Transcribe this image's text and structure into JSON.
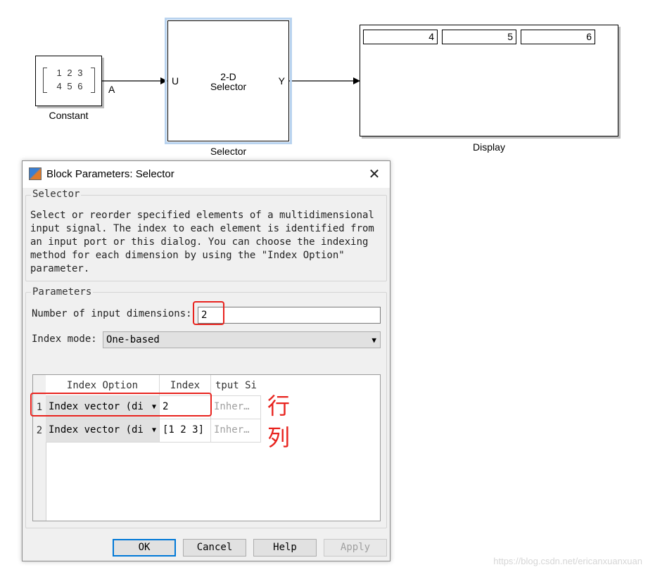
{
  "diagram": {
    "constant": {
      "matrix_rows": [
        "1  2  3",
        "4  5  6"
      ],
      "port_out": "A",
      "label": "Constant"
    },
    "selector": {
      "title_line1": "2-D",
      "title_line2": "Selector",
      "port_in": "U",
      "port_out": "Y",
      "label": "Selector"
    },
    "display": {
      "values": [
        "4",
        "5",
        "6"
      ],
      "label": "Display"
    }
  },
  "dialog": {
    "title": "Block Parameters: Selector",
    "selector_group_title": "Selector",
    "description": "Select or reorder specified elements of a multidimensional\ninput signal. The index to each element is identified from\nan input port or this dialog. You can choose the indexing\nmethod for each dimension by using the \"Index Option\"\nparameter.",
    "parameters_group_title": "Parameters",
    "num_dims_label": "Number of input dimensions:",
    "num_dims_value": "2",
    "index_mode_label": "Index mode:",
    "index_mode_value": "One-based",
    "table": {
      "headers": [
        "Index Option",
        "Index",
        "tput Si"
      ],
      "rows": [
        {
          "num": "1",
          "option": "Index vector (di",
          "index": "2",
          "output_size": "Inher…"
        },
        {
          "num": "2",
          "option": "Index vector (di",
          "index": "[1 2 3]",
          "output_size": "Inher…"
        }
      ]
    },
    "buttons": {
      "ok": "OK",
      "cancel": "Cancel",
      "help": "Help",
      "apply": "Apply"
    }
  },
  "annotations": {
    "row_note": "行",
    "col_note": "列",
    "color": "#e8231e"
  },
  "watermark": "https://blog.csdn.net/ericanxuanxuan"
}
